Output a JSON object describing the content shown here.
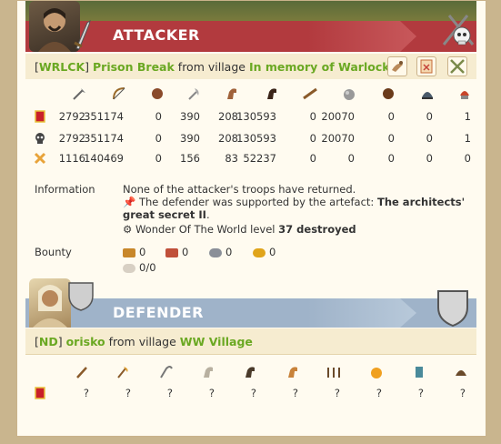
{
  "attacker": {
    "title": "ATTACKER",
    "alliance": "WRLCK",
    "player": "Prison Break",
    "from_label": "from village",
    "village": "In memory of Warlock",
    "troop_icons": [
      "clubswinger-icon",
      "bowman-icon",
      "hero-head-icon",
      "axe-icon",
      "horse-icon",
      "dark-horse-icon",
      "ram-icon",
      "catapult-icon",
      "chief-icon",
      "settler-icon",
      "hero-icon"
    ],
    "rows": [
      {
        "type": "troops",
        "values": [
          "2792",
          "351174",
          "0",
          "390",
          "208",
          "130593",
          "0",
          "20070",
          "0",
          "0",
          "1"
        ]
      },
      {
        "type": "dead",
        "values": [
          "2792",
          "351174",
          "0",
          "390",
          "208",
          "130593",
          "0",
          "20070",
          "0",
          "0",
          "1"
        ]
      },
      {
        "type": "trapped",
        "values": [
          "1116",
          "140469",
          "0",
          "156",
          "83",
          "52237",
          "0",
          "0",
          "0",
          "0",
          "0"
        ]
      }
    ],
    "information_label": "Information",
    "info_line1": "None of the attacker's troops have returned.",
    "info_line2_prefix": "The defender was supported by the artefact: ",
    "info_line2_bold": "The architects' great secret II",
    "info_line2_suffix": ".",
    "info_line3_prefix": "Wonder Of The World level ",
    "info_line3_bold": "37 destroyed",
    "bounty_label": "Bounty",
    "bounty": {
      "wood": "0",
      "clay": "0",
      "iron": "0",
      "crop": "0",
      "carry": "0/0"
    }
  },
  "defender": {
    "title": "DEFENDER",
    "alliance": "ND",
    "player": "orisko",
    "from_label": "from village",
    "village": "WW Village",
    "troop_icons": [
      "club-icon",
      "axe-icon",
      "scythe-icon",
      "scout-icon",
      "horse-icon",
      "cavalry-icon",
      "ram-icon",
      "catapult-icon",
      "chief-icon",
      "settler-icon",
      "hero-icon"
    ],
    "values": [
      "?",
      "?",
      "?",
      "?",
      "?",
      "?",
      "?",
      "?",
      "?",
      "?",
      "?"
    ]
  }
}
